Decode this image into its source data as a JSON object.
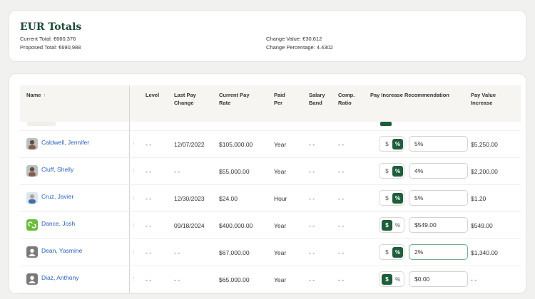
{
  "summary": {
    "title": "EUR Totals",
    "current_total": "Current Total: €660,376",
    "proposed_total": "Proposed Total: €690,988",
    "change_value": "Change Value: €30,612",
    "change_percentage": "Change Percentage: 4.4302"
  },
  "table": {
    "columns": {
      "name": "Name",
      "level": "Level",
      "last_pay_change": [
        "Last Pay",
        "Change"
      ],
      "current_pay_rate": [
        "Current Pay",
        "Rate"
      ],
      "paid_per": [
        "Paid",
        "Per"
      ],
      "salary_band": [
        "Salary",
        "Band"
      ],
      "comp_ratio": [
        "Comp.",
        "Ratio"
      ],
      "pay_increase": "Pay Increase Recommendation",
      "pay_value_increase": [
        "Pay Value",
        "Increase"
      ]
    },
    "rows": [
      {
        "name": "Caldwell, Jennifer",
        "avatar": "photo-woman-icon",
        "level": "- -",
        "last_pay_change": "12/07/2022",
        "current_pay_rate": "$105,000.00",
        "paid_per": "Year",
        "salary_band": "- -",
        "comp_ratio": "- -",
        "mode": "percent",
        "dollar_symbol": "$",
        "percent_symbol": "%",
        "input_value": "5%",
        "pay_value_increase": "$5,250.00"
      },
      {
        "name": "Cluff, Shelly",
        "avatar": "photo-woman-icon",
        "level": "- -",
        "last_pay_change": "- -",
        "current_pay_rate": "$55,000.00",
        "paid_per": "Year",
        "salary_band": "- -",
        "comp_ratio": "- -",
        "mode": "percent",
        "dollar_symbol": "$",
        "percent_symbol": "%",
        "input_value": "4%",
        "pay_value_increase": "$2,200.00"
      },
      {
        "name": "Cruz, Javier",
        "avatar": "photo-man-icon",
        "level": "- -",
        "last_pay_change": "12/30/2023",
        "current_pay_rate": "$24.00",
        "paid_per": "Hour",
        "salary_band": "- -",
        "comp_ratio": "- -",
        "mode": "percent",
        "dollar_symbol": "$",
        "percent_symbol": "%",
        "input_value": "5%",
        "pay_value_increase": "$1.20"
      },
      {
        "name": "Dance, Josh",
        "avatar": "green-logo-icon",
        "level": "- -",
        "last_pay_change": "09/18/2024",
        "current_pay_rate": "$400,000.00",
        "paid_per": "Year",
        "salary_band": "- -",
        "comp_ratio": "- -",
        "mode": "dollar",
        "dollar_symbol": "$",
        "percent_symbol": "%",
        "input_value": "$549.00",
        "pay_value_increase": "$549.00"
      },
      {
        "name": "Dean, Yasmine",
        "avatar": "person-placeholder-icon",
        "level": "- -",
        "last_pay_change": "- -",
        "current_pay_rate": "$67,000.00",
        "paid_per": "Year",
        "salary_band": "- -",
        "comp_ratio": "- -",
        "mode": "percent",
        "dollar_symbol": "$",
        "percent_symbol": "%",
        "input_value": "2%",
        "pay_value_increase": "$1,340.00",
        "focused": true
      },
      {
        "name": "Diaz, Anthony",
        "avatar": "person-placeholder-icon",
        "level": "- -",
        "last_pay_change": "- -",
        "current_pay_rate": "$65,000.00",
        "paid_per": "Year",
        "salary_band": "- -",
        "comp_ratio": "- -",
        "mode": "dollar",
        "dollar_symbol": "$",
        "percent_symbol": "%",
        "input_value": "$0.00",
        "pay_value_increase": "- -"
      }
    ]
  },
  "colors": {
    "accent": "#1e5e3d",
    "link": "#2a63b8",
    "title": "#1f4a35"
  }
}
